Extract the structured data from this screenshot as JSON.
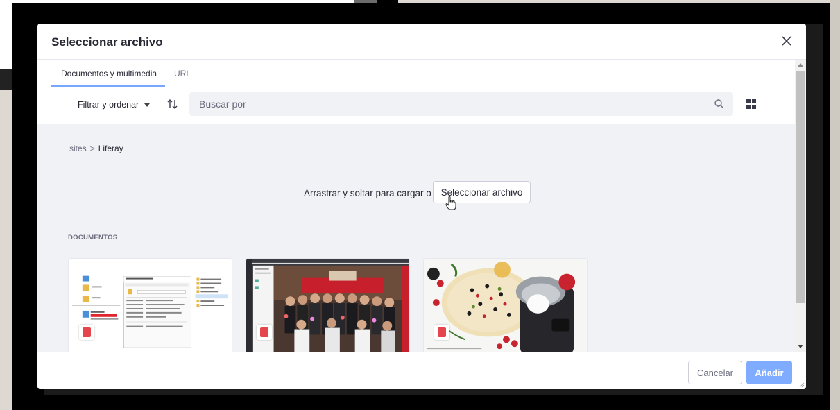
{
  "modal": {
    "title": "Seleccionar archivo",
    "close_icon": "close-icon"
  },
  "tabs": [
    {
      "label": "Documentos y multimedia",
      "active": true
    },
    {
      "label": "URL",
      "active": false
    }
  ],
  "toolbar": {
    "filter_label": "Filtrar y ordenar",
    "sort_icon": "sort-arrows-icon",
    "search_placeholder": "Buscar por",
    "search_icon": "search-icon",
    "view_icon": "grid-view-icon"
  },
  "breadcrumb": {
    "items": [
      "sites",
      "Liferay"
    ],
    "separator": ">"
  },
  "upload": {
    "drop_text": "Arrastrar y soltar para cargar o",
    "select_button": "Seleccionar archivo"
  },
  "documents": {
    "section_label": "DOCUMENTOS",
    "items": [
      {
        "type": "image",
        "icon": "image-file-icon",
        "thumbnail": "screenshot-file-properties"
      },
      {
        "type": "image",
        "icon": "image-file-icon",
        "thumbnail": "group-photo"
      },
      {
        "type": "image",
        "icon": "image-file-icon",
        "thumbnail": "food-and-kitchen-robot"
      }
    ]
  },
  "footer": {
    "cancel_label": "Cancelar",
    "add_label": "Añadir"
  },
  "colors": {
    "accent": "#0b5fff",
    "add_button_disabled": "#80acff",
    "content_bg": "#f1f2f5",
    "file_icon_red": "#e5464d"
  }
}
